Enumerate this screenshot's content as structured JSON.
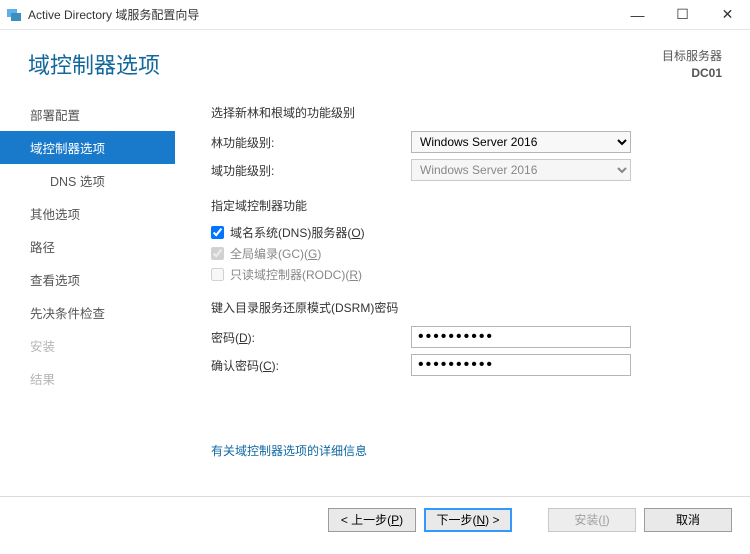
{
  "window": {
    "title": "Active Directory 域服务配置向导",
    "minimize": "—",
    "maximize": "☐",
    "close": "✕"
  },
  "header": {
    "title": "域控制器选项",
    "target_label": "目标服务器",
    "target_value": "DC01"
  },
  "nav": {
    "items": [
      {
        "label": "部署配置",
        "state": "normal"
      },
      {
        "label": "域控制器选项",
        "state": "selected"
      },
      {
        "label": "DNS 选项",
        "state": "sub"
      },
      {
        "label": "其他选项",
        "state": "normal"
      },
      {
        "label": "路径",
        "state": "normal"
      },
      {
        "label": "查看选项",
        "state": "normal"
      },
      {
        "label": "先决条件检查",
        "state": "normal"
      },
      {
        "label": "安装",
        "state": "disabled"
      },
      {
        "label": "结果",
        "state": "disabled"
      }
    ]
  },
  "content": {
    "section_level": "选择新林和根域的功能级别",
    "forest_label": "林功能级别:",
    "forest_value": "Windows Server 2016",
    "domain_label": "域功能级别:",
    "domain_value": "Windows Server 2016",
    "section_capabilities": "指定域控制器功能",
    "cb_dns": "域名系统(DNS)服务器(",
    "cb_dns_u": "O",
    "cb_dns_end": ")",
    "cb_gc": "全局编录(GC)(",
    "cb_gc_u": "G",
    "cb_gc_end": ")",
    "cb_rodc": "只读域控制器(RODC)(",
    "cb_rodc_u": "R",
    "cb_rodc_end": ")",
    "section_dsrm": "键入目录服务还原模式(DSRM)密码",
    "pw_label": "密码(",
    "pw_u": "D",
    "pw_end": "):",
    "pw_value": "••••••••••",
    "pwc_label": "确认密码(",
    "pwc_u": "C",
    "pwc_end": "):",
    "pwc_value": "••••••••••",
    "link": "有关域控制器选项的详细信息"
  },
  "footer": {
    "prev": "< 上一步(",
    "prev_u": "P",
    "prev_end": ")",
    "next": "下一步(",
    "next_u": "N",
    "next_end": ") >",
    "install": "安装(",
    "install_u": "I",
    "install_end": ")",
    "cancel": "取消"
  }
}
